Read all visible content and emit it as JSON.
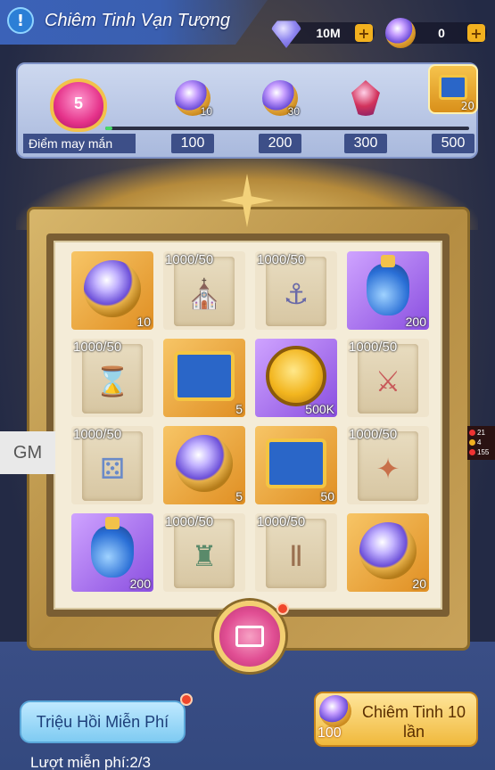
{
  "header": {
    "title": "Chiêm Tinh Vạn Tượng",
    "currencies": [
      {
        "icon": "diamond-icon",
        "value": "10M"
      },
      {
        "icon": "star-orb-icon",
        "value": "0"
      }
    ],
    "plus_label": "+"
  },
  "luck": {
    "label": "Điểm may mắn",
    "level": "5",
    "progress": 0.02,
    "milestones": [
      "100",
      "200",
      "300",
      "500"
    ],
    "rewards": [
      {
        "icon": "star-orb-icon",
        "count": "10"
      },
      {
        "icon": "star-orb-icon",
        "count": "30"
      },
      {
        "icon": "crystal-icon",
        "count": "2"
      },
      {
        "icon": "chest-icon",
        "count": "20"
      }
    ]
  },
  "grid": [
    {
      "type": "orange",
      "icon": "star-orb-icon",
      "top": "",
      "bottom": "10"
    },
    {
      "type": "paper",
      "icon": "scroll-tower-icon",
      "top": "1000/50",
      "bottom": ""
    },
    {
      "type": "paper",
      "icon": "scroll-anchor-icon",
      "top": "1000/50",
      "bottom": ""
    },
    {
      "type": "purple",
      "icon": "potion-icon",
      "top": "",
      "bottom": "200"
    },
    {
      "type": "paper",
      "icon": "scroll-hourglass-icon",
      "top": "1000/50",
      "bottom": ""
    },
    {
      "type": "orange",
      "icon": "chest-icon",
      "top": "",
      "bottom": "5"
    },
    {
      "type": "purple",
      "icon": "gold-coin-icon",
      "top": "",
      "bottom": "500K"
    },
    {
      "type": "paper",
      "icon": "scroll-swords-icon",
      "top": "1000/50",
      "bottom": ""
    },
    {
      "type": "paper",
      "icon": "scroll-dice-icon",
      "top": "1000/50",
      "bottom": ""
    },
    {
      "type": "orange",
      "icon": "star-orb-icon",
      "top": "",
      "bottom": "5"
    },
    {
      "type": "orange",
      "icon": "chest-icon",
      "top": "",
      "bottom": "50"
    },
    {
      "type": "paper",
      "icon": "scroll-wings-icon",
      "top": "1000/50",
      "bottom": ""
    },
    {
      "type": "purple",
      "icon": "potion-icon",
      "top": "",
      "bottom": "200"
    },
    {
      "type": "paper",
      "icon": "scroll-rook-icon",
      "top": "1000/50",
      "bottom": ""
    },
    {
      "type": "paper",
      "icon": "scroll-pillar-icon",
      "top": "1000/50",
      "bottom": ""
    },
    {
      "type": "orange",
      "icon": "star-orb-icon",
      "top": "",
      "bottom": "20"
    }
  ],
  "side": {
    "gm_label": "GM",
    "stats": [
      "21",
      "4",
      "155"
    ]
  },
  "actions": {
    "free_summon_label": "Triệu Hồi Miễn Phí",
    "pull10_label": "Chiêm Tinh 10 lần",
    "pull10_cost": "100",
    "free_count": "Lượt miễn phí:2/3"
  }
}
